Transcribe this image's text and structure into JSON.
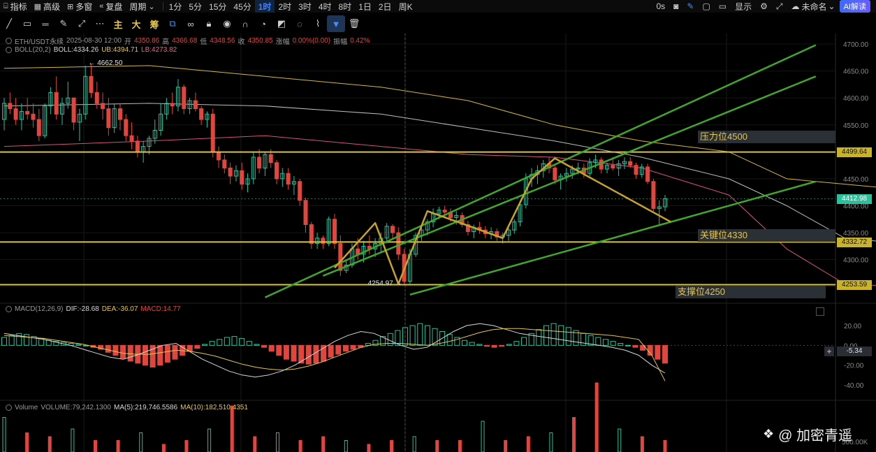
{
  "topbar": {
    "items": [
      {
        "label": "指标",
        "icon": "indicator-icon"
      },
      {
        "label": "高级",
        "icon": "calendar-icon"
      },
      {
        "label": "多窗",
        "icon": "grid-icon"
      },
      {
        "label": "复盘",
        "icon": "replay-icon"
      },
      {
        "label": "周期",
        "icon": "chevron-down-icon"
      }
    ],
    "timeframes": [
      "1分",
      "5分",
      "15分",
      "45分",
      "1时",
      "2时",
      "3时",
      "4时",
      "8时",
      "1日",
      "2日",
      "周K"
    ],
    "active_timeframe": "1时",
    "right": {
      "countdown": "0s",
      "display_label": "显示",
      "layout_name": "未命名",
      "ai_label": "AI解读"
    }
  },
  "toolbar2": {
    "text_buttons": [
      "主",
      "大",
      "筹"
    ]
  },
  "legend": {
    "symbol": "ETH/USDT永续",
    "datetime": "2025-08-30 12:00",
    "open_label": "开",
    "open": "4350.86",
    "high_label": "高",
    "high": "4366.68",
    "low_label": "低",
    "low": "4348.56",
    "close_label": "收",
    "close": "4350.85",
    "change_label": "涨幅",
    "change": "0.00%(0.00)",
    "amp_label": "振幅",
    "amp": "0.42%",
    "boll_name": "BOLL(20,2)",
    "boll_mid": "BOLL:4334.26",
    "boll_ub": "UB:4394.71",
    "boll_lb": "LB:4273.82",
    "macd_name": "MACD(12,26,9)",
    "dif": "DIF:-28.68",
    "dea": "DEA:-36.07",
    "macd": "MACD:14.77",
    "volume_name": "Volume",
    "volume": "VOLUME:79,242.1300",
    "ma5": "MA(5):219,746.5586",
    "ma10": "MA(10):182,510.4351"
  },
  "levels": {
    "resistance": {
      "label": "压力位4500",
      "price": 4499.64,
      "tag": "4499.64"
    },
    "key": {
      "label": "关键位4330",
      "price": 4332.72,
      "tag": "4332.72"
    },
    "support": {
      "label": "支撑位4250",
      "price": 4253.59,
      "tag": "4253.59"
    },
    "current": {
      "price": 4412.98,
      "tag": "4412.98"
    },
    "macd_current": "-5.34"
  },
  "annotations": {
    "high_label": "4662.50",
    "low_label": "4254.97"
  },
  "watermark": "@ 加密青遥",
  "colors": {
    "up": "#2bbf9a",
    "down": "#e0463e",
    "trend": "#3fa82a",
    "level": "#d9c43a",
    "pattern": "#c9a22c",
    "boll_mid": "#bdbdbd",
    "boll_ub": "#d8b73a",
    "boll_lb": "#d9507e"
  },
  "chart_data": [
    {
      "type": "candlestick",
      "title": "ETH/USDT永续",
      "price_axis": {
        "ticks": [
          4700,
          4650,
          4600,
          4550,
          4500,
          4450,
          4400,
          4350,
          4300,
          4250
        ],
        "ylim": [
          4245,
          4712
        ]
      },
      "ohlc": [
        [
          4560,
          4600,
          4540,
          4590
        ],
        [
          4590,
          4610,
          4570,
          4580
        ],
        [
          4580,
          4600,
          4550,
          4560
        ],
        [
          4560,
          4590,
          4540,
          4575
        ],
        [
          4575,
          4600,
          4560,
          4570
        ],
        [
          4570,
          4590,
          4545,
          4560
        ],
        [
          4560,
          4580,
          4520,
          4530
        ],
        [
          4530,
          4590,
          4525,
          4585
        ],
        [
          4585,
          4620,
          4570,
          4610
        ],
        [
          4610,
          4640,
          4560,
          4570
        ],
        [
          4570,
          4600,
          4550,
          4590
        ],
        [
          4590,
          4630,
          4580,
          4600
        ],
        [
          4600,
          4600,
          4540,
          4555
        ],
        [
          4555,
          4580,
          4520,
          4570
        ],
        [
          4570,
          4660,
          4560,
          4640
        ],
        [
          4640,
          4662.5,
          4600,
          4610
        ],
        [
          4610,
          4630,
          4580,
          4590
        ],
        [
          4590,
          4610,
          4560,
          4580
        ],
        [
          4580,
          4600,
          4530,
          4545
        ],
        [
          4545,
          4590,
          4535,
          4580
        ],
        [
          4580,
          4590,
          4540,
          4560
        ],
        [
          4560,
          4570,
          4520,
          4530
        ],
        [
          4530,
          4555,
          4505,
          4520
        ],
        [
          4520,
          4530,
          4490,
          4500
        ],
        [
          4500,
          4520,
          4480,
          4510
        ],
        [
          4510,
          4530,
          4495,
          4525
        ],
        [
          4525,
          4560,
          4515,
          4540
        ],
        [
          4540,
          4590,
          4530,
          4570
        ],
        [
          4570,
          4600,
          4560,
          4590
        ],
        [
          4590,
          4610,
          4570,
          4585
        ],
        [
          4585,
          4635,
          4575,
          4620
        ],
        [
          4620,
          4625,
          4570,
          4580
        ],
        [
          4580,
          4600,
          4570,
          4595
        ],
        [
          4595,
          4610,
          4575,
          4580
        ],
        [
          4580,
          4585,
          4550,
          4560
        ],
        [
          4560,
          4575,
          4545,
          4570
        ],
        [
          4570,
          4580,
          4490,
          4500
        ],
        [
          4500,
          4510,
          4470,
          4485
        ],
        [
          4485,
          4495,
          4460,
          4470
        ],
        [
          4470,
          4480,
          4440,
          4455
        ],
        [
          4455,
          4475,
          4445,
          4465
        ],
        [
          4465,
          4480,
          4430,
          4440
        ],
        [
          4440,
          4460,
          4425,
          4450
        ],
        [
          4450,
          4500,
          4440,
          4490
        ],
        [
          4490,
          4505,
          4460,
          4470
        ],
        [
          4470,
          4500,
          4455,
          4495
        ],
        [
          4495,
          4505,
          4470,
          4480
        ],
        [
          4480,
          4485,
          4440,
          4450
        ],
        [
          4450,
          4470,
          4435,
          4460
        ],
        [
          4460,
          4470,
          4430,
          4440
        ],
        [
          4440,
          4455,
          4420,
          4445
        ],
        [
          4445,
          4450,
          4400,
          4410
        ],
        [
          4410,
          4415,
          4350,
          4365
        ],
        [
          4365,
          4370,
          4320,
          4330
        ],
        [
          4330,
          4350,
          4320,
          4340
        ],
        [
          4340,
          4345,
          4320,
          4330
        ],
        [
          4330,
          4380,
          4325,
          4375
        ],
        [
          4375,
          4385,
          4320,
          4330
        ],
        [
          4330,
          4345,
          4270,
          4280
        ],
        [
          4280,
          4300,
          4275,
          4290
        ],
        [
          4290,
          4330,
          4285,
          4320
        ],
        [
          4320,
          4340,
          4300,
          4310
        ],
        [
          4310,
          4335,
          4295,
          4325
        ],
        [
          4325,
          4345,
          4310,
          4320
        ],
        [
          4320,
          4340,
          4305,
          4330
        ],
        [
          4330,
          4350,
          4315,
          4340
        ],
        [
          4340,
          4368,
          4330,
          4362
        ],
        [
          4362,
          4366,
          4340,
          4350
        ],
        [
          4350,
          4360,
          4300,
          4310
        ],
        [
          4310,
          4320,
          4254.97,
          4260
        ],
        [
          4260,
          4320,
          4255,
          4310
        ],
        [
          4310,
          4350,
          4305,
          4345
        ],
        [
          4345,
          4365,
          4335,
          4355
        ],
        [
          4355,
          4375,
          4345,
          4370
        ],
        [
          4370,
          4395,
          4360,
          4385
        ],
        [
          4385,
          4398,
          4375,
          4392
        ],
        [
          4392,
          4400,
          4380,
          4388
        ],
        [
          4388,
          4395,
          4370,
          4378
        ],
        [
          4378,
          4390,
          4365,
          4382
        ],
        [
          4382,
          4388,
          4360,
          4365
        ],
        [
          4365,
          4372,
          4345,
          4352
        ],
        [
          4352,
          4365,
          4340,
          4360
        ],
        [
          4360,
          4370,
          4348,
          4355
        ],
        [
          4355,
          4362,
          4340,
          4348
        ],
        [
          4348,
          4360,
          4338,
          4352
        ],
        [
          4352,
          4358,
          4335,
          4342
        ],
        [
          4342,
          4350,
          4330,
          4345
        ],
        [
          4345,
          4360,
          4335,
          4355
        ],
        [
          4355,
          4375,
          4348,
          4370
        ],
        [
          4370,
          4410,
          4362,
          4402
        ],
        [
          4402,
          4460,
          4395,
          4450
        ],
        [
          4450,
          4470,
          4435,
          4458
        ],
        [
          4458,
          4475,
          4440,
          4465
        ],
        [
          4465,
          4485,
          4452,
          4478
        ],
        [
          4478,
          4490,
          4460,
          4470
        ],
        [
          4470,
          4475,
          4440,
          4448
        ],
        [
          4448,
          4460,
          4430,
          4455
        ],
        [
          4455,
          4470,
          4445,
          4460
        ],
        [
          4460,
          4475,
          4450,
          4468
        ],
        [
          4468,
          4480,
          4458,
          4470
        ],
        [
          4470,
          4478,
          4452,
          4460
        ],
        [
          4460,
          4488,
          4455,
          4480
        ],
        [
          4480,
          4495,
          4470,
          4485
        ],
        [
          4485,
          4490,
          4460,
          4468
        ],
        [
          4468,
          4480,
          4460,
          4475
        ],
        [
          4475,
          4490,
          4465,
          4470
        ],
        [
          4470,
          4485,
          4455,
          4478
        ],
        [
          4478,
          4490,
          4468,
          4482
        ],
        [
          4482,
          4490,
          4470,
          4475
        ],
        [
          4475,
          4480,
          4450,
          4458
        ],
        [
          4458,
          4478,
          4452,
          4472
        ],
        [
          4472,
          4478,
          4440,
          4445
        ],
        [
          4445,
          4450,
          4390,
          4395
        ],
        [
          4395,
          4410,
          4365,
          4398
        ],
        [
          4398,
          4420,
          4390,
          4412.98
        ]
      ],
      "boll_ub_points": [
        [
          0,
          4655
        ],
        [
          25,
          4660
        ],
        [
          45,
          4640
        ],
        [
          65,
          4620
        ],
        [
          80,
          4595
        ],
        [
          95,
          4550
        ],
        [
          110,
          4520
        ],
        [
          125,
          4500
        ],
        [
          135,
          4450
        ],
        [
          145,
          4440
        ],
        [
          155,
          4430
        ],
        [
          165,
          4410
        ],
        [
          180,
          4395
        ],
        [
          200,
          4400
        ],
        [
          225,
          4430
        ],
        [
          240,
          4470
        ],
        [
          245,
          4500
        ],
        [
          255,
          4525
        ],
        [
          265,
          4500
        ],
        [
          275,
          4490
        ],
        [
          285,
          4500
        ]
      ],
      "boll_mid_points": [
        [
          0,
          4585
        ],
        [
          25,
          4590
        ],
        [
          45,
          4585
        ],
        [
          65,
          4570
        ],
        [
          80,
          4545
        ],
        [
          95,
          4520
        ],
        [
          110,
          4490
        ],
        [
          125,
          4450
        ],
        [
          135,
          4400
        ],
        [
          145,
          4340
        ],
        [
          155,
          4330
        ],
        [
          165,
          4345
        ],
        [
          180,
          4360
        ],
        [
          200,
          4375
        ],
        [
          225,
          4400
        ],
        [
          240,
          4430
        ],
        [
          255,
          4455
        ],
        [
          265,
          4470
        ],
        [
          275,
          4465
        ],
        [
          285,
          4455
        ]
      ],
      "boll_lb_points": [
        [
          0,
          4510
        ],
        [
          25,
          4520
        ],
        [
          45,
          4530
        ],
        [
          65,
          4510
        ],
        [
          80,
          4495
        ],
        [
          95,
          4490
        ],
        [
          110,
          4470
        ],
        [
          125,
          4420
        ],
        [
          135,
          4320
        ],
        [
          145,
          4255
        ],
        [
          155,
          4250
        ],
        [
          165,
          4275
        ],
        [
          180,
          4320
        ],
        [
          200,
          4330
        ],
        [
          225,
          4300
        ],
        [
          240,
          4295
        ],
        [
          255,
          4310
        ],
        [
          265,
          4380
        ],
        [
          275,
          4440
        ],
        [
          285,
          4425
        ]
      ]
    },
    {
      "type": "bar",
      "title": "MACD(12,26,9)",
      "ylim": [
        -55,
        30
      ],
      "ticks": [
        20,
        0,
        -20,
        -40
      ],
      "histogram": [
        8,
        10,
        12,
        11,
        9,
        7,
        5,
        4,
        3,
        2,
        1,
        0,
        -2,
        -4,
        -7,
        -10,
        -13,
        -16,
        -18,
        -20,
        -22,
        -20,
        -17,
        -14,
        -10,
        -6,
        -3,
        1,
        4,
        6,
        8,
        9,
        7,
        4,
        1,
        -2,
        -6,
        -10,
        -14,
        -16,
        -18,
        -19,
        -18,
        -16,
        -12,
        -9,
        -6,
        -4,
        -2,
        2,
        5,
        9,
        12,
        15,
        18,
        20,
        22,
        20,
        17,
        14,
        11,
        8,
        5,
        3,
        1,
        -1,
        -2,
        -1,
        1,
        4,
        8,
        12,
        16,
        20,
        22,
        20,
        18,
        15,
        12,
        10,
        8,
        6,
        4,
        2,
        0,
        -2,
        -5,
        -10,
        -14,
        -18
      ],
      "dif": [
        12,
        10,
        8,
        6,
        3,
        0,
        -4,
        -8,
        -12,
        -14,
        -10,
        -5,
        0,
        2,
        -6,
        -14,
        -20,
        -26,
        -30,
        -32,
        -30,
        -26,
        -20,
        -12,
        -4,
        4,
        10,
        14,
        12,
        6,
        0,
        -4,
        -2,
        6,
        14,
        20,
        22,
        20,
        16,
        12,
        10,
        8,
        6,
        4,
        2,
        0,
        -2,
        -5,
        -10,
        -20,
        -28
      ],
      "dea": [
        10,
        9,
        8,
        7,
        5,
        3,
        1,
        -2,
        -5,
        -8,
        -9,
        -9,
        -7,
        -5,
        -6,
        -8,
        -11,
        -15,
        -19,
        -22,
        -24,
        -25,
        -24,
        -21,
        -17,
        -12,
        -7,
        -2,
        1,
        2,
        2,
        1,
        0,
        2,
        5,
        9,
        13,
        16,
        17,
        17,
        16,
        15,
        14,
        13,
        12,
        11,
        10,
        8,
        6,
        -10,
        -36
      ]
    },
    {
      "type": "bar",
      "title": "Volume",
      "values": [
        0.9,
        0.5,
        0.4,
        0.6,
        0.3,
        0.3,
        0.5,
        0.2,
        0.3,
        0.6,
        1.2,
        0.4,
        0.5,
        0.3,
        0.4,
        0.3,
        0.2,
        0.3,
        0.4,
        0.3,
        0.3,
        0.8,
        0.3,
        0.4,
        0.5,
        0.9,
        1.8,
        0.6,
        0.4,
        0.3
      ]
    }
  ]
}
